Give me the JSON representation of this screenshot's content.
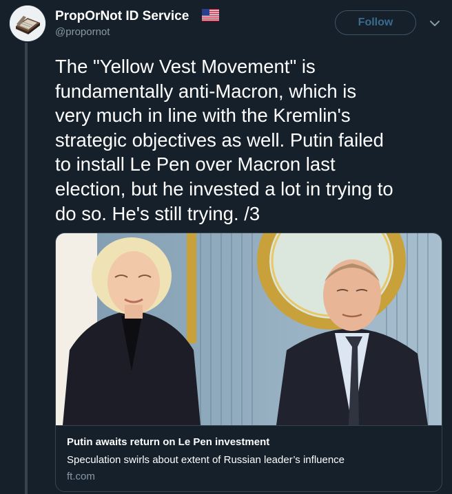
{
  "author": {
    "display_name": "PropOrNot ID Service",
    "handle": "@propornot",
    "flag_icon": "us-flag-icon",
    "avatar_icon": "book-avatar-icon"
  },
  "follow_button": {
    "label": "Follow"
  },
  "menu_icon": "chevron-down-icon",
  "tweet": {
    "text_lines": [
      "The \"Yellow Vest Movement\" is",
      "fundamentally anti-Macron, which is",
      "very much in line with the Kremlin's",
      "strategic objectives as well. Putin failed",
      "to install Le Pen over Macron last",
      "election, but he invested a lot in trying to",
      "do so. He's still trying. /3"
    ]
  },
  "link_card": {
    "title": "Putin awaits return on Le Pen investment",
    "description": "Speculation swirls about extent of Russian leader’s influence",
    "domain": "ft.com"
  },
  "colors": {
    "background": "#15202b",
    "text": "#ffffff",
    "muted": "#8899a6",
    "border": "#38444d",
    "follow_text": "#3b6b8f"
  }
}
